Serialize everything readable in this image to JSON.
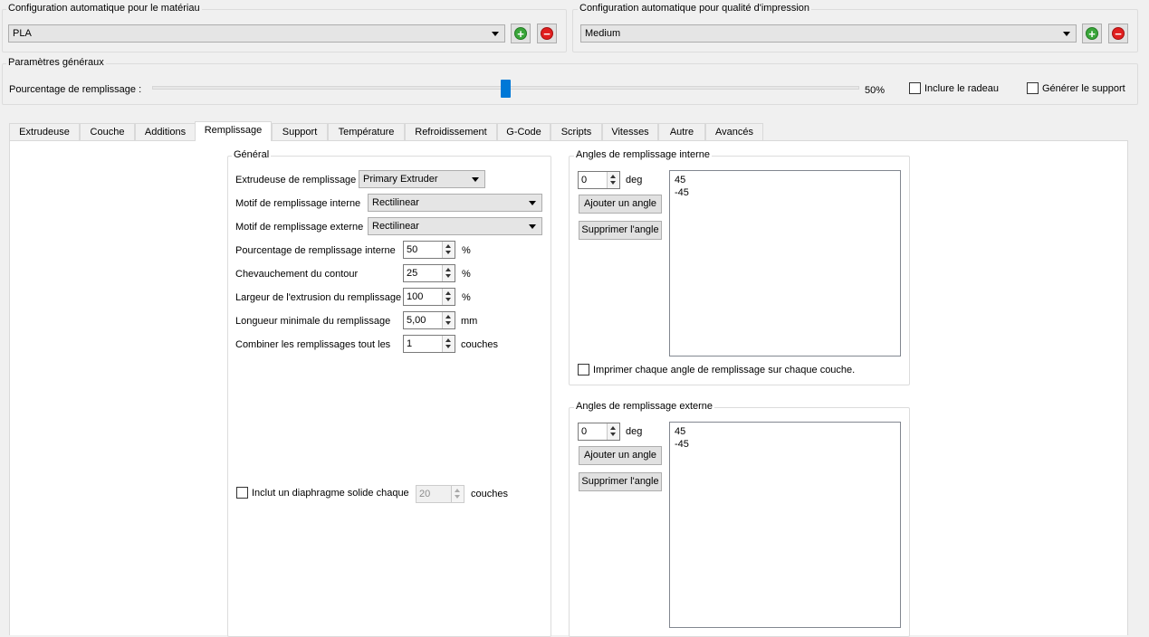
{
  "material": {
    "title": "Configuration automatique pour le matériau",
    "selected": "PLA"
  },
  "quality": {
    "title": "Configuration automatique pour qualité d'impression",
    "selected": "Medium"
  },
  "general": {
    "title": "Paramètres généraux",
    "infill_label": "Pourcentage de remplissage :",
    "infill_value": "50%",
    "infill_fraction": 0.5,
    "raft_label": "Inclure le radeau",
    "support_label": "Générer le support"
  },
  "tabs": [
    {
      "label": "Extrudeuse"
    },
    {
      "label": "Couche"
    },
    {
      "label": "Additions"
    },
    {
      "label": "Remplissage"
    },
    {
      "label": "Support"
    },
    {
      "label": "Température"
    },
    {
      "label": "Refroidissement"
    },
    {
      "label": "G-Code"
    },
    {
      "label": "Scripts"
    },
    {
      "label": "Vitesses"
    },
    {
      "label": "Autre"
    },
    {
      "label": "Avancés"
    }
  ],
  "active_tab": "Remplissage",
  "infill": {
    "title": "Général",
    "extruder_label": "Extrudeuse de remplissage",
    "extruder_value": "Primary Extruder",
    "internal_pattern_label": "Motif de remplissage interne",
    "internal_pattern_value": "Rectilinear",
    "external_pattern_label": "Motif de remplissage externe",
    "external_pattern_value": "Rectilinear",
    "internal_pct_label": "Pourcentage de remplissage interne",
    "internal_pct_value": "50",
    "internal_pct_unit": "%",
    "outline_overlap_label": "Chevauchement du contour",
    "outline_overlap_value": "25",
    "outline_overlap_unit": "%",
    "extrusion_width_label": "Largeur de l'extrusion du remplissage",
    "extrusion_width_value": "100",
    "extrusion_width_unit": "%",
    "min_length_label": "Longueur minimale du remplissage",
    "min_length_value": "5,00",
    "min_length_unit": "mm",
    "combine_label": "Combiner les remplissages tout les",
    "combine_value": "1",
    "combine_unit": "couches",
    "diaphragm_label": "Inclut un diaphragme solide chaque",
    "diaphragm_value": "20",
    "diaphragm_unit": "couches"
  },
  "internal_angles": {
    "title": "Angles de remplissage interne",
    "angle_value": "0",
    "angle_unit": "deg",
    "add_label": "Ajouter un angle",
    "remove_label": "Supprimer l'angle",
    "list": [
      "45",
      "-45"
    ],
    "print_each_label": "Imprimer chaque angle de remplissage sur chaque couche."
  },
  "external_angles": {
    "title": "Angles de remplissage externe",
    "angle_value": "0",
    "angle_unit": "deg",
    "add_label": "Ajouter un angle",
    "remove_label": "Supprimer l'angle",
    "list": [
      "45",
      "-45"
    ]
  },
  "icons": {
    "add": "plus-circle-icon",
    "remove": "minus-circle-icon",
    "dropdown": "chevron-down-icon"
  }
}
